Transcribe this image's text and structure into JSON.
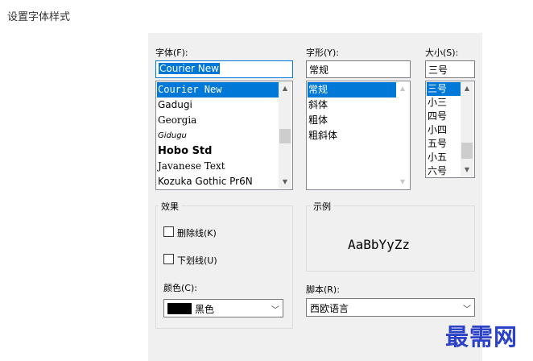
{
  "page": {
    "heading": "设置字体样式"
  },
  "font": {
    "label": "字体(F):",
    "value": "Courier New",
    "items": [
      "Courier New",
      "Gadugi",
      "Georgia",
      "Gidugu",
      "Hobo Std",
      "Javanese Text",
      "Kozuka Gothic Pr6N"
    ],
    "selected_index": 0
  },
  "style": {
    "label": "字形(Y):",
    "value": "常规",
    "items": [
      "常规",
      "斜体",
      "粗体",
      "粗斜体"
    ],
    "selected_index": 0
  },
  "size": {
    "label": "大小(S):",
    "value": "三号",
    "items": [
      "三号",
      "小三",
      "四号",
      "小四",
      "五号",
      "小五",
      "六号"
    ],
    "selected_index": 0
  },
  "effects": {
    "title": "效果",
    "strikeout_label": "删除线(K)",
    "strikeout_checked": false,
    "underline_label": "下划线(U)",
    "underline_checked": false
  },
  "color": {
    "label": "颜色(C):",
    "value": "黑色",
    "swatch": "#000000"
  },
  "sample": {
    "title": "示例",
    "text": "AaBbYyZz"
  },
  "script": {
    "label": "脚本(R):",
    "value": "西欧语言"
  },
  "watermark": {
    "text": "最需网",
    "color": "#2a41c8"
  },
  "icons": {
    "scroll_up": "▲",
    "scroll_down": "▼",
    "dropdown": "﹀"
  }
}
